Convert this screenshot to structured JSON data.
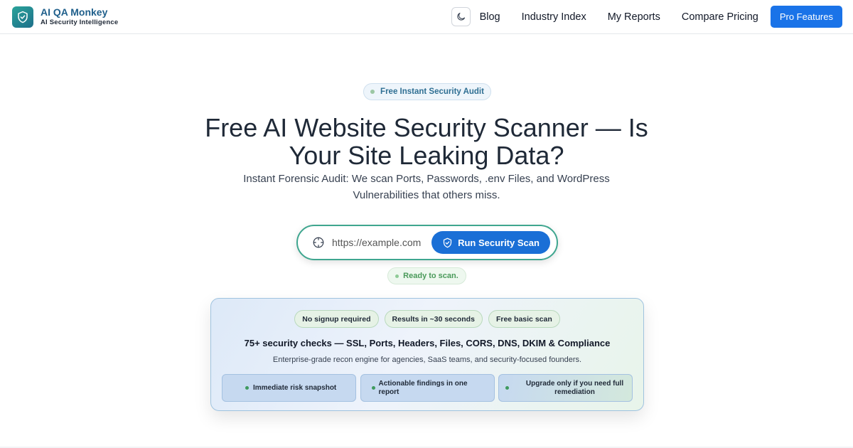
{
  "header": {
    "brand_title": "AI QA Monkey",
    "brand_subtitle": "AI Security Intelligence",
    "logo_icon": "shield-check-icon",
    "theme_icon": "moon-icon",
    "nav": [
      {
        "label": "Blog"
      },
      {
        "label": "Industry Index"
      },
      {
        "label": "My Reports"
      },
      {
        "label": "Compare Pricing"
      }
    ],
    "cta_label": "Pro Features"
  },
  "hero": {
    "pill_label": "Free Instant Security Audit",
    "title": "Free AI Website Security Scanner — Is Your Site Leaking Data?",
    "subtitle": "Instant Forensic Audit: We scan Ports, Passwords, .env Files, and WordPress Vulnerabilities that others miss."
  },
  "scan": {
    "input_placeholder": "https://example.com",
    "input_icon": "crosshair-icon",
    "button_label": "Run Security Scan",
    "button_icon": "shield-icon",
    "status": "Ready to scan."
  },
  "card": {
    "tags": [
      "No signup required",
      "Results in ~30 seconds",
      "Free basic scan"
    ],
    "title": "75+ security checks — SSL, Ports, Headers, Files, CORS, DNS, DKIM & Compliance",
    "description": "Enterprise-grade recon engine for agencies, SaaS teams, and security-focused founders.",
    "features": [
      {
        "label": "Immediate risk snapshot"
      },
      {
        "label": "Actionable findings in one report"
      },
      {
        "label": "Upgrade only if you need full remediation"
      }
    ]
  },
  "colors": {
    "accent": "#1a73e8",
    "brand": "#1f5f8b",
    "success": "#3f9a5e",
    "input_border": "#3fa68f"
  }
}
